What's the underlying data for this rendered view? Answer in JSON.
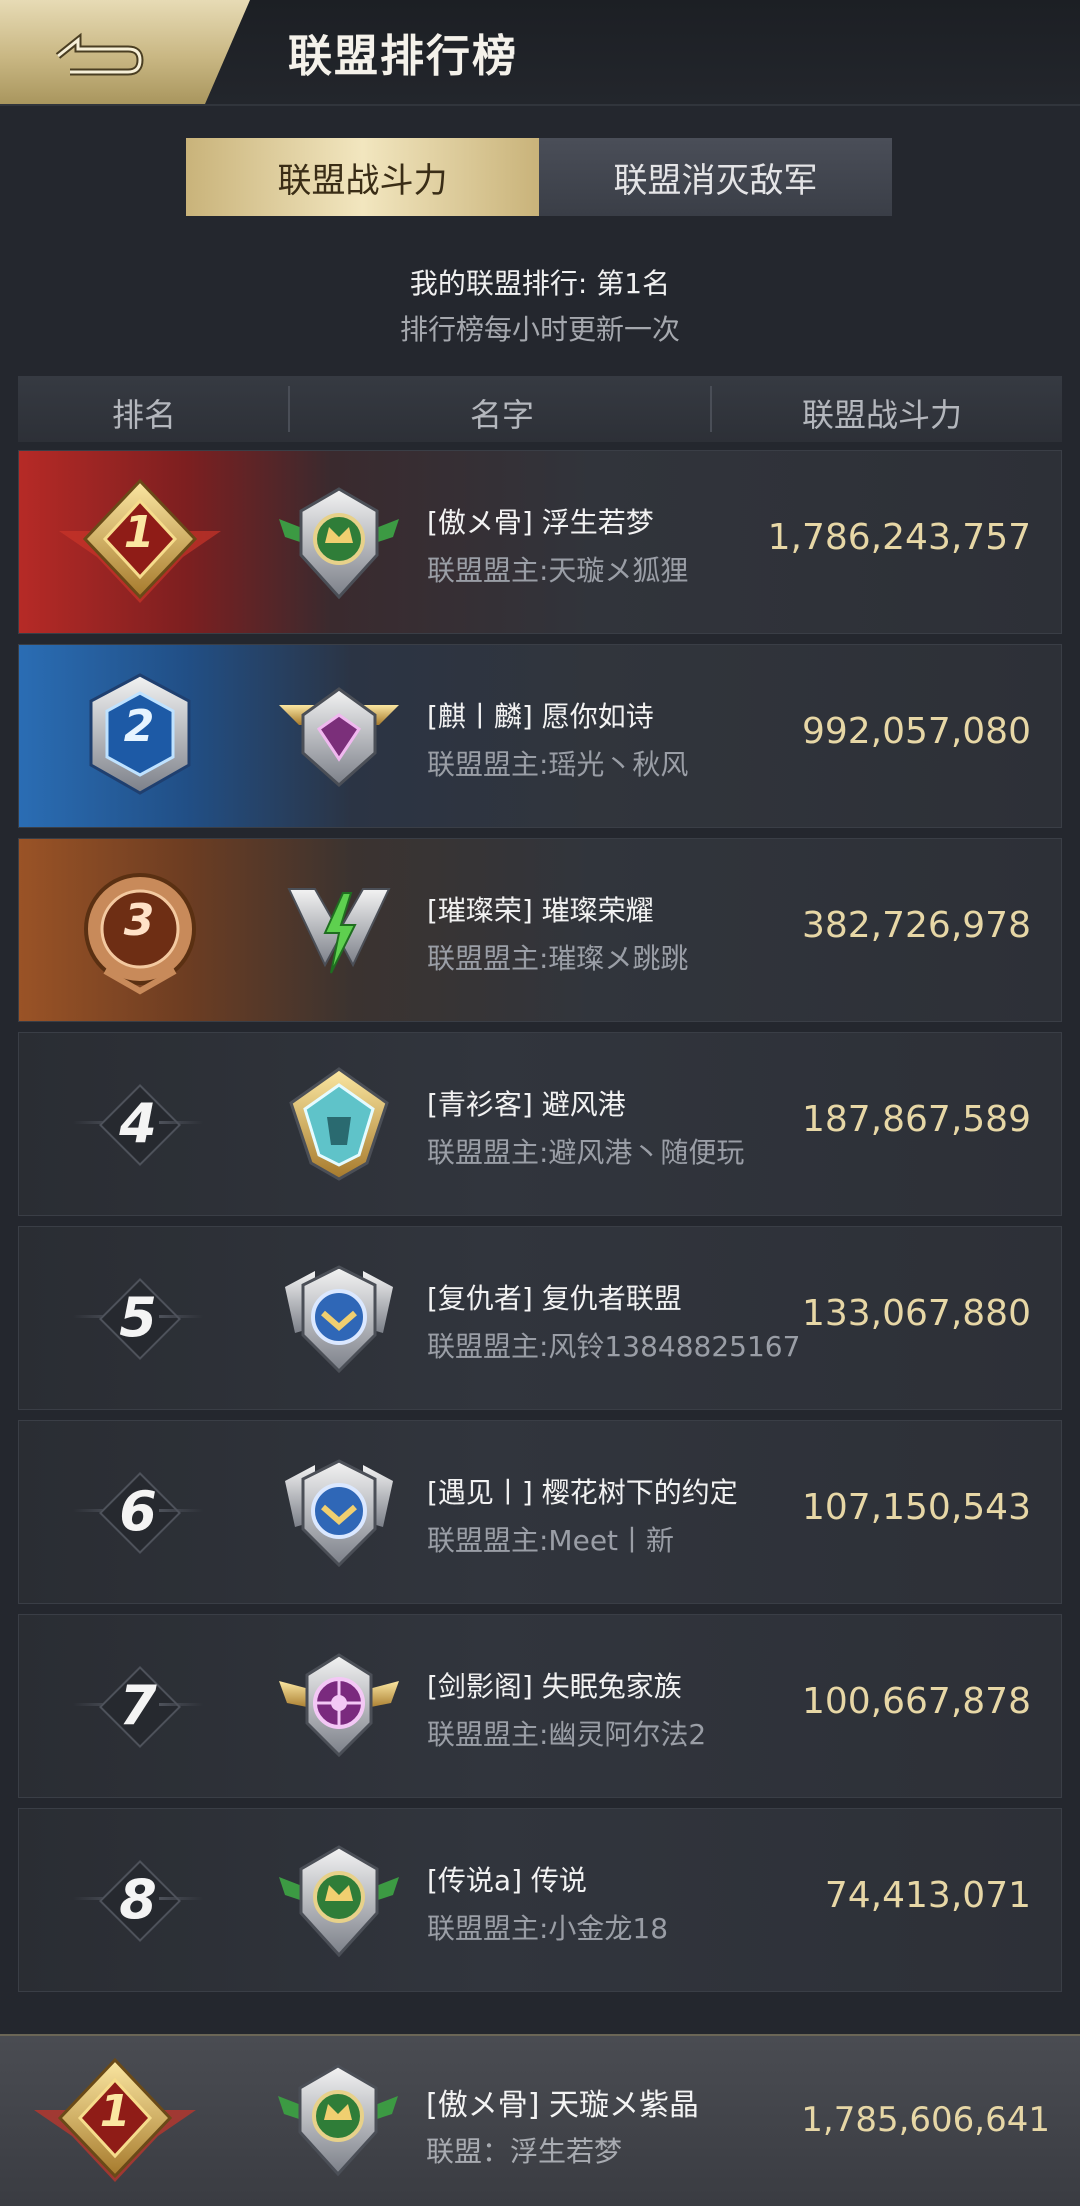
{
  "header": {
    "title": "联盟排行榜"
  },
  "tabs": [
    {
      "label": "联盟战斗力",
      "active": true
    },
    {
      "label": "联盟消灭敌军",
      "active": false
    }
  ],
  "info": {
    "my_rank": "我的联盟排行: 第1名",
    "update_note": "排行榜每小时更新一次"
  },
  "columns": {
    "rank": "排名",
    "name": "名字",
    "power": "联盟战斗力"
  },
  "rows": [
    {
      "rank": "1",
      "name": "[傲メ骨] 浮生若梦",
      "leader": "联盟盟主:天璇メ狐狸",
      "power": "1,786,243,757"
    },
    {
      "rank": "2",
      "name": "[麒丨麟] 愿你如诗",
      "leader": "联盟盟主:瑶光丶秋风",
      "power": "992,057,080"
    },
    {
      "rank": "3",
      "name": "[璀璨荣] 璀璨荣耀",
      "leader": "联盟盟主:璀璨メ跳跳",
      "power": "382,726,978"
    },
    {
      "rank": "4",
      "name": "[青衫客] 避风港",
      "leader": "联盟盟主:避风港丶随便玩",
      "power": "187,867,589"
    },
    {
      "rank": "5",
      "name": "[复仇者] 复仇者联盟",
      "leader": "联盟盟主:风铃13848825167",
      "power": "133,067,880"
    },
    {
      "rank": "6",
      "name": "[遇见丨] 樱花树下的约定",
      "leader": "联盟盟主:Meet丨新",
      "power": "107,150,543"
    },
    {
      "rank": "7",
      "name": "[剑影阁] 失眠兔家族",
      "leader": "联盟盟主:幽灵阿尔法2",
      "power": "100,667,878"
    },
    {
      "rank": "8",
      "name": "[传说a] 传说",
      "leader": "联盟盟主:小金龙18",
      "power": "74,413,071"
    }
  ],
  "my_alliance": {
    "rank": "1",
    "name": "[傲メ骨] 天璇メ紫晶",
    "alliance": "联盟：浮生若梦",
    "power": "1,785,606,641"
  },
  "colors": {
    "gold_text": "#e7d7a6",
    "tab_gold": "#f2e6bf",
    "bg": "#24272e",
    "rank1": "#b62a26",
    "rank2": "#2a6db4",
    "rank3": "#9a5326"
  }
}
